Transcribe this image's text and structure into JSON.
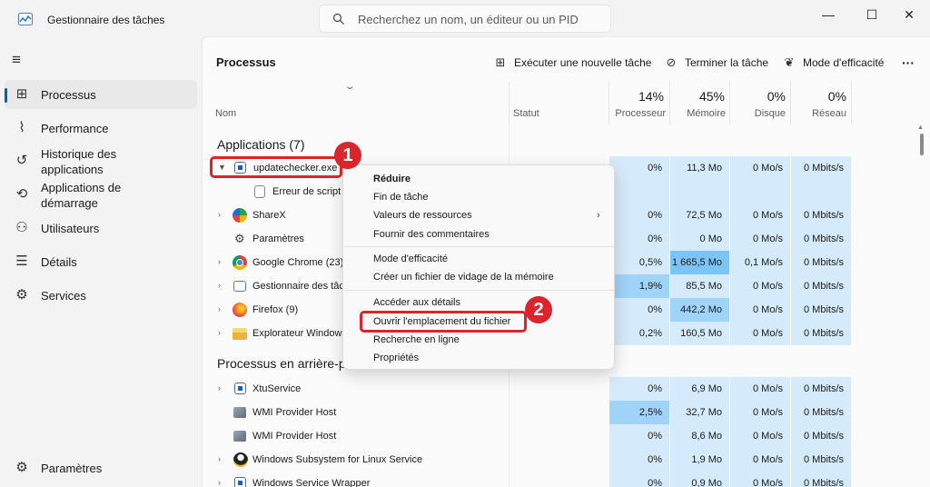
{
  "app": {
    "title": "Gestionnaire des tâches"
  },
  "search": {
    "placeholder": "Recherchez un nom, un éditeur ou un PID"
  },
  "window": {
    "minimize": "—",
    "maximize": "☐",
    "close": "✕"
  },
  "sidebar": {
    "items": [
      {
        "label": "Processus",
        "icon": "grid-icon"
      },
      {
        "label": "Performance",
        "icon": "pulse-icon"
      },
      {
        "label": "Historique des applications",
        "icon": "history-icon"
      },
      {
        "label": "Applications de démarrage",
        "icon": "startup-icon"
      },
      {
        "label": "Utilisateurs",
        "icon": "users-icon"
      },
      {
        "label": "Détails",
        "icon": "list-icon"
      },
      {
        "label": "Services",
        "icon": "puzzle-icon"
      }
    ],
    "settings": "Paramètres"
  },
  "toolbar": {
    "title": "Processus",
    "run_task": "Exécuter une nouvelle tâche",
    "end_task": "Terminer la tâche",
    "efficiency": "Mode d'efficacité",
    "more": "···"
  },
  "columns": {
    "name": "Nom",
    "status": "Statut",
    "cpu_pct": "14%",
    "cpu": "Processeur",
    "mem_pct": "45%",
    "mem": "Mémoire",
    "disk_pct": "0%",
    "disk": "Disque",
    "net_pct": "0%",
    "net": "Réseau"
  },
  "sections": {
    "apps": "Applications (7)",
    "background": "Processus en arrière-p"
  },
  "rows": [
    {
      "name": "updatechecker.exe",
      "cpu": "0%",
      "mem": "11,3 Mo",
      "disk": "0 Mo/s",
      "net": "0 Mbits/s"
    },
    {
      "name": "Erreur de script"
    },
    {
      "name": "ShareX",
      "cpu": "0%",
      "mem": "72,5 Mo",
      "disk": "0 Mo/s",
      "net": "0 Mbits/s"
    },
    {
      "name": "Paramètres",
      "cpu": "0%",
      "mem": "0 Mo",
      "disk": "0 Mo/s",
      "net": "0 Mbits/s"
    },
    {
      "name": "Google Chrome (23)",
      "cpu": "0,5%",
      "mem": "1 665,5 Mo",
      "disk": "0,1 Mo/s",
      "net": "0 Mbits/s"
    },
    {
      "name": "Gestionnaire des tâc",
      "cpu": "1,9%",
      "mem": "85,5 Mo",
      "disk": "0 Mo/s",
      "net": "0 Mbits/s"
    },
    {
      "name": "Firefox (9)",
      "cpu": "0%",
      "mem": "442,2 Mo",
      "disk": "0 Mo/s",
      "net": "0 Mbits/s"
    },
    {
      "name": "Explorateur Windows",
      "cpu": "0,2%",
      "mem": "160,5 Mo",
      "disk": "0 Mo/s",
      "net": "0 Mbits/s"
    },
    {
      "name": "XtuService",
      "cpu": "0%",
      "mem": "6,9 Mo",
      "disk": "0 Mo/s",
      "net": "0 Mbits/s"
    },
    {
      "name": "WMI Provider Host",
      "cpu": "2,5%",
      "mem": "32,7 Mo",
      "disk": "0 Mo/s",
      "net": "0 Mbits/s"
    },
    {
      "name": "WMI Provider Host",
      "cpu": "0%",
      "mem": "8,6 Mo",
      "disk": "0 Mo/s",
      "net": "0 Mbits/s"
    },
    {
      "name": "Windows Subsystem for Linux Service",
      "cpu": "0%",
      "mem": "1,9 Mo",
      "disk": "0 Mo/s",
      "net": "0 Mbits/s"
    },
    {
      "name": "Windows Service Wrapper",
      "cpu": "0%",
      "mem": "0,9 Mo",
      "disk": "0 Mo/s",
      "net": "0 Mbits/s"
    }
  ],
  "context_menu": {
    "items": [
      "Réduire",
      "Fin de tâche",
      "Valeurs de ressources",
      "Fournir des commentaires",
      "Mode d'efficacité",
      "Créer un fichier de vidage de la mémoire",
      "Accéder aux détails",
      "Ouvrir l'emplacement du fichier",
      "Recherche en ligne",
      "Propriétés"
    ]
  },
  "annotations": {
    "badge1": "1",
    "badge2": "2"
  },
  "colors": {
    "accent": "#005fb8",
    "highlight": "#d9252b",
    "heat_low": "#d5ebfb",
    "heat_mid": "#9fd3f8",
    "heat_high": "#7cc4f5"
  }
}
